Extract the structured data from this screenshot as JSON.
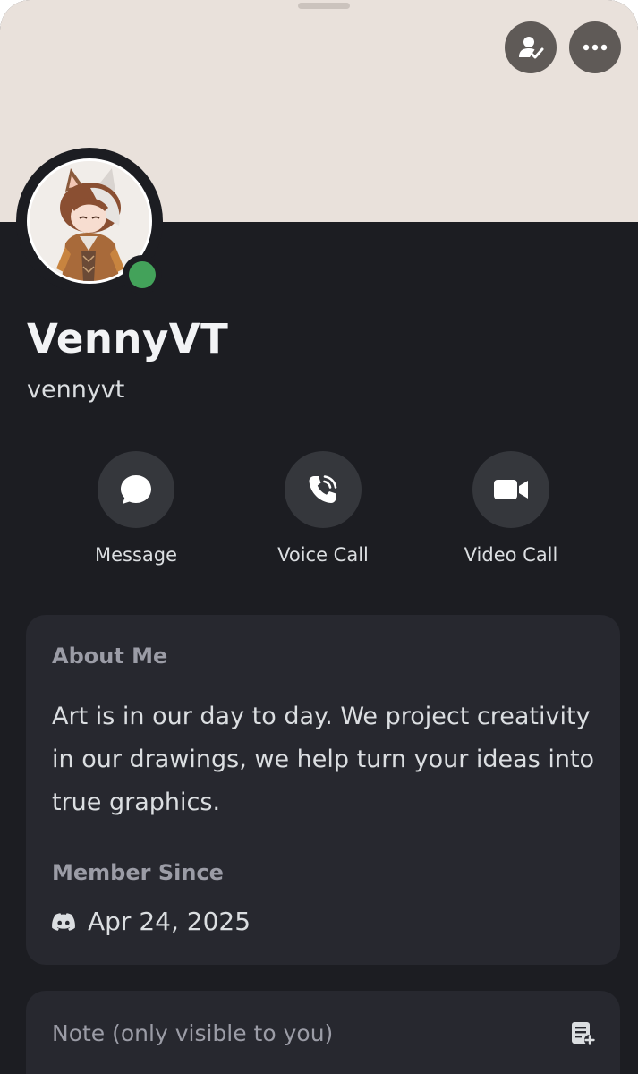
{
  "header": {
    "banner_color": "#e9e1db",
    "top_buttons": [
      {
        "icon": "friend-check-icon"
      },
      {
        "icon": "more-options-icon"
      }
    ]
  },
  "profile": {
    "display_name": "VennyVT",
    "username": "vennyvt",
    "status": "online",
    "status_color": "#43a25a"
  },
  "actions": {
    "message_label": "Message",
    "voice_call_label": "Voice Call",
    "video_call_label": "Video Call"
  },
  "about": {
    "title": "About Me",
    "text": "Art is in our day to day. We project creativity in our drawings, we help turn your ideas into true graphics.",
    "member_since_title": "Member Since",
    "member_since_date": "Apr 24, 2025"
  },
  "note": {
    "label": "Note (only visible to you)"
  }
}
